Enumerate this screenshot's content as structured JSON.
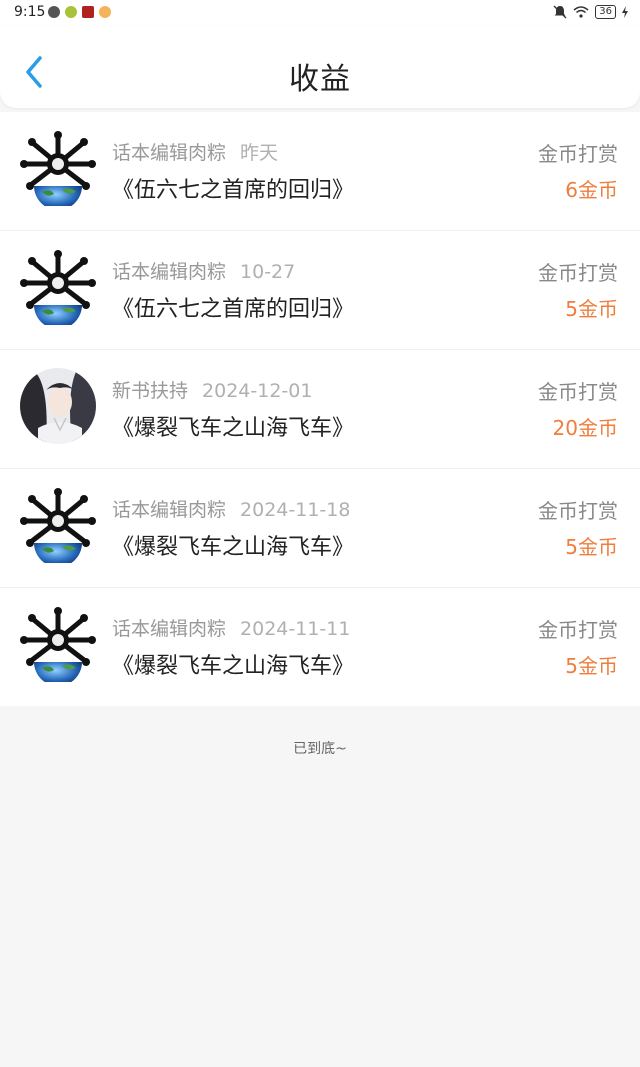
{
  "status_bar": {
    "time": "9:15",
    "battery": "36"
  },
  "header": {
    "title": "收益"
  },
  "records": [
    {
      "name": "话本编辑肉粽",
      "date": "昨天",
      "book": "《伍六七之首席的回归》",
      "type": "金币打赏",
      "amount": "6金币",
      "avatar": "skull-bones-avatar"
    },
    {
      "name": "话本编辑肉粽",
      "date": "10-27",
      "book": "《伍六七之首席的回归》",
      "type": "金币打赏",
      "amount": "5金币",
      "avatar": "skull-bones-avatar"
    },
    {
      "name": "新书扶持",
      "date": "2024-12-01",
      "book": "《爆裂飞车之山海飞车》",
      "type": "金币打赏",
      "amount": "20金币",
      "avatar": "anime-character-avatar"
    },
    {
      "name": "话本编辑肉粽",
      "date": "2024-11-18",
      "book": "《爆裂飞车之山海飞车》",
      "type": "金币打赏",
      "amount": "5金币",
      "avatar": "skull-bones-avatar"
    },
    {
      "name": "话本编辑肉粽",
      "date": "2024-11-11",
      "book": "《爆裂飞车之山海飞车》",
      "type": "金币打赏",
      "amount": "5金币",
      "avatar": "skull-bones-avatar"
    }
  ],
  "footer": {
    "end_text": "已到底~"
  },
  "colors": {
    "amount": "#ef7e3d",
    "back_arrow": "#2b9de8"
  }
}
